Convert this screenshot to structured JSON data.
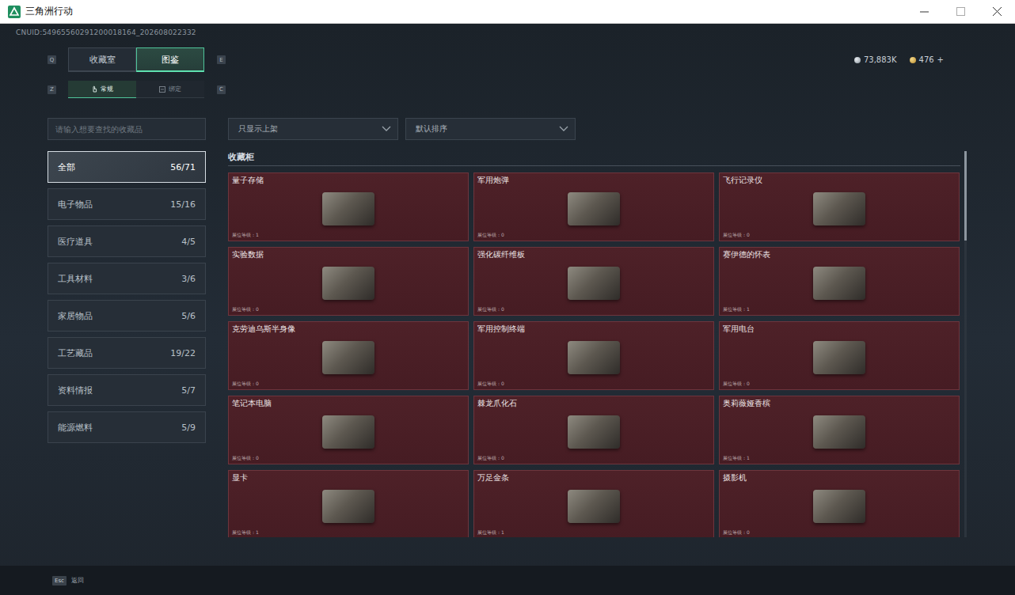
{
  "window": {
    "title": "三角洲行动"
  },
  "account": {
    "id": "CNUID:54965560291200018164_202608022332"
  },
  "currencies": [
    {
      "amount": "73,883K",
      "action": ""
    },
    {
      "amount": "476",
      "action": "+"
    }
  ],
  "tabs": {
    "prev_key": "Q",
    "next_key": "E",
    "items": [
      {
        "label": "收藏室",
        "selected": false
      },
      {
        "label": "图鉴",
        "selected": true
      }
    ]
  },
  "sub_tabs": {
    "prev_key": "Z",
    "next_key": "C",
    "items": [
      {
        "label": "常规",
        "selected": true
      },
      {
        "label": "绑定",
        "selected": false
      }
    ]
  },
  "search": {
    "placeholder": "请输入想要查找的收藏品"
  },
  "filters": [
    {
      "label": "只显示上架"
    },
    {
      "label": "默认排序"
    }
  ],
  "sidebar": {
    "items": [
      {
        "label": "全部",
        "count": "56/71",
        "selected": true
      },
      {
        "label": "电子物品",
        "count": "15/16",
        "selected": false
      },
      {
        "label": "医疗道具",
        "count": "4/5",
        "selected": false
      },
      {
        "label": "工具材料",
        "count": "3/6",
        "selected": false
      },
      {
        "label": "家居物品",
        "count": "5/6",
        "selected": false
      },
      {
        "label": "工艺藏品",
        "count": "19/22",
        "selected": false
      },
      {
        "label": "资料情报",
        "count": "5/7",
        "selected": false
      },
      {
        "label": "能源燃料",
        "count": "5/9",
        "selected": false
      }
    ]
  },
  "section": {
    "title": "收藏柜"
  },
  "cards": [
    {
      "name": "量子存储",
      "level_label": "展位等级：1"
    },
    {
      "name": "军用炮弹",
      "level_label": "展位等级：0"
    },
    {
      "name": "飞行记录仪",
      "level_label": "展位等级：0"
    },
    {
      "name": "实验数据",
      "level_label": "展位等级：0"
    },
    {
      "name": "强化碳纤维板",
      "level_label": "展位等级：0"
    },
    {
      "name": "赛伊德的怀表",
      "level_label": "展位等级：1"
    },
    {
      "name": "克劳迪乌斯半身像",
      "level_label": "展位等级：0"
    },
    {
      "name": "军用控制终端",
      "level_label": "展位等级：0"
    },
    {
      "name": "军用电台",
      "level_label": "展位等级：0"
    },
    {
      "name": "笔记本电脑",
      "level_label": "展位等级：0"
    },
    {
      "name": "棘龙爪化石",
      "level_label": "展位等级：0"
    },
    {
      "name": "奥莉薇娅香槟",
      "level_label": "展位等级：1"
    },
    {
      "name": "显卡",
      "level_label": "展位等级：1"
    },
    {
      "name": "万足金条",
      "level_label": "展位等级：1"
    },
    {
      "name": "摄影机",
      "level_label": "展位等级：0"
    }
  ],
  "footer": {
    "key": "Esc",
    "label": "返回"
  }
}
